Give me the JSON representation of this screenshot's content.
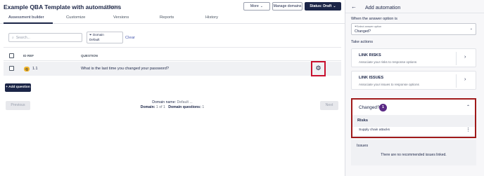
{
  "header": {
    "title": "Example QBA Template with automations",
    "tag": "Template",
    "more_label": "More",
    "manage_domains_label": "Manage domains",
    "status_label": "Status: Draft"
  },
  "tabs": [
    {
      "label": "Assessment builder",
      "active": true
    },
    {
      "label": "Customize",
      "active": false
    },
    {
      "label": "Versions",
      "active": false
    },
    {
      "label": "Reports",
      "active": false
    },
    {
      "label": "History",
      "active": false
    }
  ],
  "filters": {
    "search_placeholder": "Search...",
    "domain_label": "Domain",
    "domain_value": "Default",
    "clear_label": "Clear"
  },
  "table": {
    "columns": [
      "ID REF",
      "QUESTION"
    ],
    "rows": [
      {
        "badge": "Q",
        "id": "1.1",
        "question": "What is the last time you changed your password?"
      }
    ]
  },
  "add_question_label": "+ Add question",
  "pagination": {
    "previous_label": "Previous",
    "next_label": "Next",
    "domain_name_label": "Domain name:",
    "domain_name_value": "Default ...",
    "domain_label": "Domain:",
    "domain_value": "1 of 1",
    "domain_questions_label": "Domain questions:",
    "domain_questions_value": "1"
  },
  "panel": {
    "back_icon": "arrow-left-icon",
    "title": "Add automation",
    "condition_label": "When the answer option is",
    "select_sublabel": "Select answer option",
    "select_value": "Changed?",
    "actions_label": "Take actions",
    "link_risks": {
      "title": "LINK RISKS",
      "desc": "Associate your risks to response options"
    },
    "link_issues": {
      "title": "LINK ISSUES",
      "desc": "Associate your issues to response options"
    },
    "automation": {
      "title": "Changed?",
      "count": "1",
      "risks_label": "Risks",
      "risk_item": "Supply chain attacks",
      "issues_label": "Issues",
      "issues_empty": "There are no recommended issues linked."
    }
  },
  "colors": {
    "navy": "#1b2547",
    "highlight_red": "#c8102e",
    "badge_yellow": "#f0b429",
    "badge_purple": "#5b2a86"
  }
}
